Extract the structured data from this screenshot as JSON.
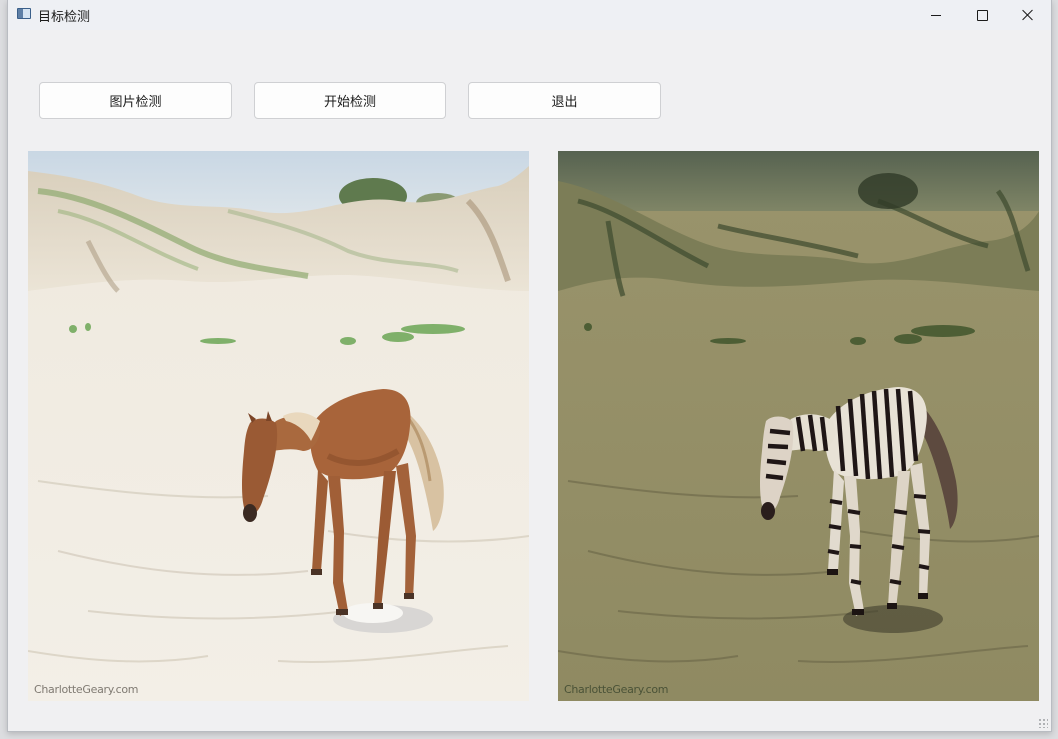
{
  "window": {
    "title": "目标检测",
    "icon": "app-window-icon",
    "controls": [
      "minimize-icon",
      "maximize-icon",
      "close-icon"
    ]
  },
  "toolbar": {
    "image_detect_label": "图片检测",
    "start_detect_label": "开始检测",
    "exit_label": "退出"
  },
  "images": {
    "source": {
      "description_icon": "horse-photo",
      "watermark": "CharlotteGeary.com"
    },
    "result": {
      "description_icon": "zebra-photo",
      "watermark": "CharlotteGeary.com"
    }
  },
  "colors": {
    "window_bg": "#f0f0f2",
    "button_bg": "#fdfdfd",
    "button_border": "#cfd0d3"
  }
}
